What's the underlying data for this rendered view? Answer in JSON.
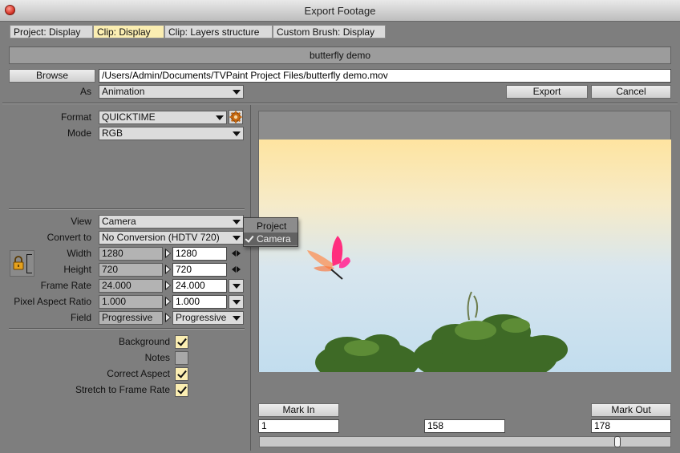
{
  "window": {
    "title": "Export Footage"
  },
  "tabs": [
    {
      "label": "Project: Display",
      "active": false
    },
    {
      "label": "Clip: Display",
      "active": true
    },
    {
      "label": "Clip: Layers structure",
      "active": false
    },
    {
      "label": "Custom Brush: Display",
      "active": false
    }
  ],
  "header": {
    "project_name": "butterfly demo"
  },
  "file": {
    "browse_label": "Browse",
    "path": "/Users/Admin/Documents/TVPaint Project Files/butterfly demo.mov",
    "as_label": "As",
    "as_value": "Animation"
  },
  "actions": {
    "export_label": "Export",
    "cancel_label": "Cancel"
  },
  "format": {
    "label": "Format",
    "value": "QUICKTIME"
  },
  "mode": {
    "label": "Mode",
    "value": "RGB"
  },
  "view": {
    "label": "View",
    "value": "Camera",
    "options": [
      {
        "label": "Project",
        "checked": false
      },
      {
        "label": "Camera",
        "checked": true
      }
    ]
  },
  "convert": {
    "label": "Convert to",
    "value": "No Conversion (HDTV 720)"
  },
  "width": {
    "label": "Width",
    "source": "1280",
    "target": "1280"
  },
  "height": {
    "label": "Height",
    "source": "720",
    "target": "720"
  },
  "frame_rate": {
    "label": "Frame Rate",
    "source": "24.000",
    "target": "24.000"
  },
  "pixel_aspect": {
    "label": "Pixel Aspect Ratio",
    "source": "1.000",
    "target": "1.000"
  },
  "field": {
    "label": "Field",
    "source": "Progressive",
    "target": "Progressive"
  },
  "options": [
    {
      "label": "Background",
      "checked": true
    },
    {
      "label": "Notes",
      "checked": false
    },
    {
      "label": "Correct Aspect",
      "checked": true
    },
    {
      "label": "Stretch to Frame Rate",
      "checked": true
    }
  ],
  "timeline": {
    "mark_in_label": "Mark In",
    "mark_out_label": "Mark Out",
    "in_value": "1",
    "current_value": "158",
    "out_value": "178",
    "position_fraction": 0.876
  }
}
